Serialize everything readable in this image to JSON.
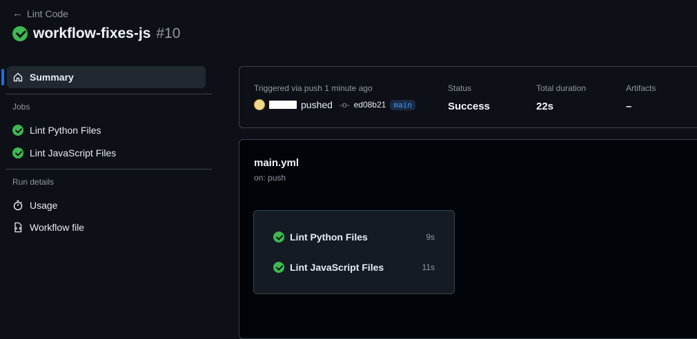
{
  "header": {
    "back_label": "Lint Code",
    "title": "workflow-fixes-js",
    "run_number": "#10"
  },
  "sidebar": {
    "summary_label": "Summary",
    "jobs_heading": "Jobs",
    "jobs": [
      {
        "label": "Lint Python Files"
      },
      {
        "label": "Lint JavaScript Files"
      }
    ],
    "run_details_heading": "Run details",
    "usage_label": "Usage",
    "workflow_file_label": "Workflow file"
  },
  "summary": {
    "trigger_text": "Triggered via push 1 minute ago",
    "pushed_text": "pushed",
    "commit_sha": "ed08b21",
    "branch": "main",
    "status_label": "Status",
    "status_value": "Success",
    "duration_label": "Total duration",
    "duration_value": "22s",
    "artifacts_label": "Artifacts",
    "artifacts_value": "–"
  },
  "graph": {
    "workflow_name": "main.yml",
    "trigger": "on: push",
    "jobs": [
      {
        "name": "Lint Python Files",
        "duration": "9s"
      },
      {
        "name": "Lint JavaScript Files",
        "duration": "11s"
      }
    ]
  },
  "colors": {
    "success": "#3fb950",
    "accent": "#1f6feb",
    "background": "#0d1117"
  }
}
